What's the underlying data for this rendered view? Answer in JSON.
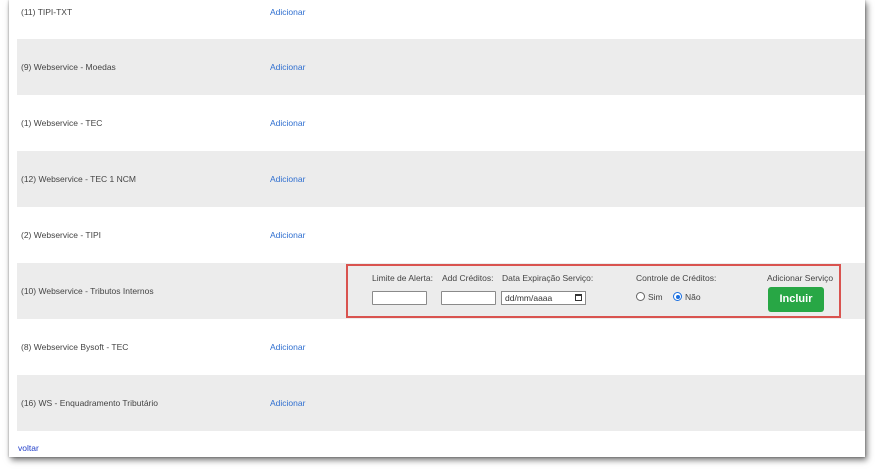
{
  "rows": [
    {
      "label": "(11) TIPI-TXT",
      "action": "Adicionar",
      "shaded": false
    },
    {
      "label": "(9) Webservice - Moedas",
      "action": "Adicionar",
      "shaded": true
    },
    {
      "label": "(1) Webservice - TEC",
      "action": "Adicionar",
      "shaded": false
    },
    {
      "label": "(12) Webservice - TEC 1 NCM",
      "action": "Adicionar",
      "shaded": true
    },
    {
      "label": "(2) Webservice - TIPI",
      "action": "Adicionar",
      "shaded": false
    },
    {
      "label": "(10) Webservice - Tributos Internos",
      "action": "",
      "shaded": true
    },
    {
      "label": "(8) Webservice Bysoft - TEC",
      "action": "Adicionar",
      "shaded": false
    },
    {
      "label": "(16) WS - Enquadramento Tributário",
      "action": "Adicionar",
      "shaded": true
    }
  ],
  "form": {
    "limite_label": "Limite de Alerta:",
    "limite_value": "",
    "creditos_label": "Add Créditos:",
    "creditos_value": "",
    "data_label": "Data Expiração Serviço:",
    "data_placeholder": "dd/mm/aaaa",
    "controle_label": "Controle de Créditos:",
    "radio_sim": "Sim",
    "radio_nao": "Não",
    "selected": "Não",
    "adicionar_label": "Adicionar Serviço",
    "incluir_button": "Incluir"
  },
  "voltar": "voltar",
  "colors": {
    "accent_link": "#2f6fd0",
    "button": "#28a745",
    "highlight_border": "#d9534f"
  }
}
